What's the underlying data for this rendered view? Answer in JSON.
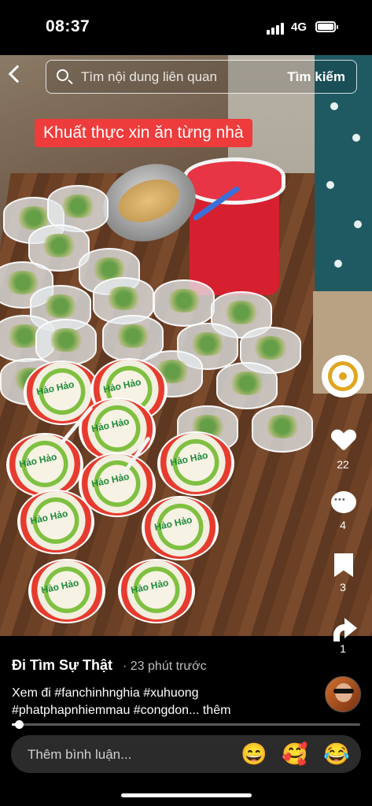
{
  "status_bar": {
    "time": "08:37",
    "network": "4G"
  },
  "search": {
    "placeholder": "Tìm nội dung liên quan",
    "button_label": "Tìm kiếm"
  },
  "video": {
    "caption_overlay": "Khuất thực xin ăn từng nhà"
  },
  "side_actions": {
    "likes": "22",
    "comments": "4",
    "saves": "3",
    "shares": "1"
  },
  "post": {
    "author": "Đi Tìm Sự Thật",
    "time_ago": "· 23 phút trước",
    "description": "Xem đi #fanchinhnghia #xuhuong #phatphapnhiemmau #congdon...",
    "more_label": "thêm",
    "progress": 0.02
  },
  "comment_bar": {
    "placeholder": "Thêm bình luận...",
    "emojis": [
      "😄",
      "🥰",
      "😂"
    ]
  },
  "noodle_label": "Hảo Hảo"
}
